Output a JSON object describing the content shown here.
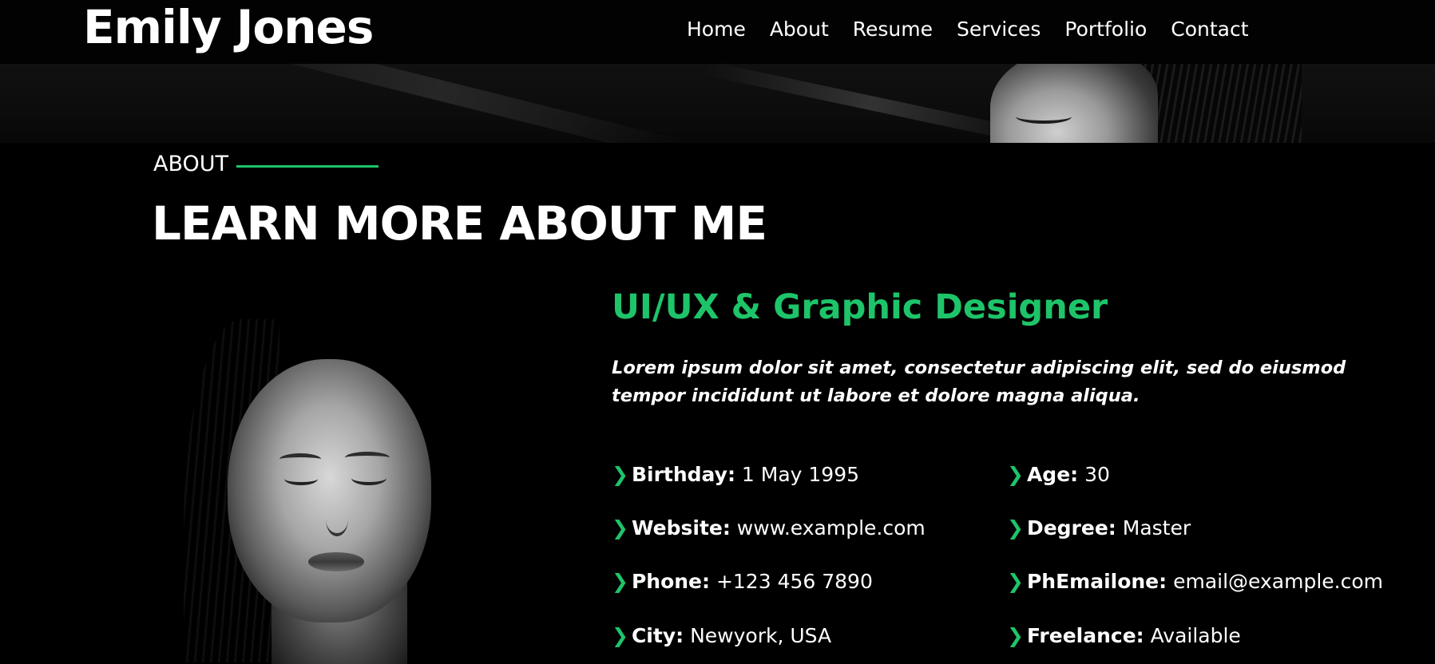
{
  "header": {
    "brand": "Emily Jones",
    "nav": [
      "Home",
      "About",
      "Resume",
      "Services",
      "Portfolio",
      "Contact"
    ]
  },
  "section": {
    "label": "ABOUT",
    "title": "LEARN MORE ABOUT ME"
  },
  "profile": {
    "role": "UI/UX & Graphic Designer",
    "intro": "Lorem ipsum dolor sit amet, consectetur adipiscing elit, sed do eiusmod tempor incididunt ut labore et dolore magna aliqua.",
    "left": [
      {
        "key": "Birthday:",
        "value": "1 May 1995"
      },
      {
        "key": "Website:",
        "value": "www.example.com"
      },
      {
        "key": "Phone:",
        "value": "+123 456 7890"
      },
      {
        "key": "City:",
        "value": "Newyork, USA"
      }
    ],
    "right": [
      {
        "key": "Age:",
        "value": "30"
      },
      {
        "key": "Degree:",
        "value": "Master"
      },
      {
        "key": "PhEmailone:",
        "value": "email@example.com"
      },
      {
        "key": "Freelance:",
        "value": "Available"
      }
    ]
  },
  "colors": {
    "accent": "#1ec469",
    "background": "#000000"
  },
  "icons": {
    "bullet": "chevron-right-icon"
  }
}
